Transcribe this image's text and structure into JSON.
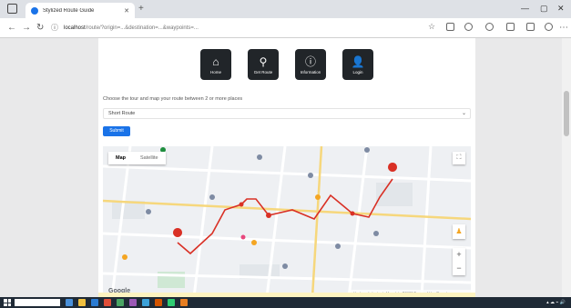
{
  "browser": {
    "tab_title": "Stylized Route Guide",
    "url_host": "localhost",
    "url_rest": "/route/?origin=...&destination=...&waypoints=..."
  },
  "nav": {
    "items": [
      {
        "label": "Home",
        "icon": "home-icon",
        "glyph": "⌂"
      },
      {
        "label": "Get Route",
        "icon": "map-marker-icon",
        "glyph": "⚲"
      },
      {
        "label": "Information",
        "icon": "info-icon",
        "glyph": "ⓘ"
      },
      {
        "label": "Login",
        "icon": "user-icon",
        "glyph": "👤"
      }
    ]
  },
  "form": {
    "help_text": "Choose the tour and map your route between 2 or more places",
    "select_value": "Short Route",
    "submit_label": "Submit"
  },
  "map": {
    "type_options": [
      "Map",
      "Satellite"
    ],
    "active_type": "Map",
    "google_label": "Google",
    "attribution": "Keyboard shortcuts   Map data ©2022   Terms of Use   Report a map error",
    "route_color": "#d93025"
  },
  "colors": {
    "nav_card": "#212529",
    "primary": "#1a73e8"
  }
}
